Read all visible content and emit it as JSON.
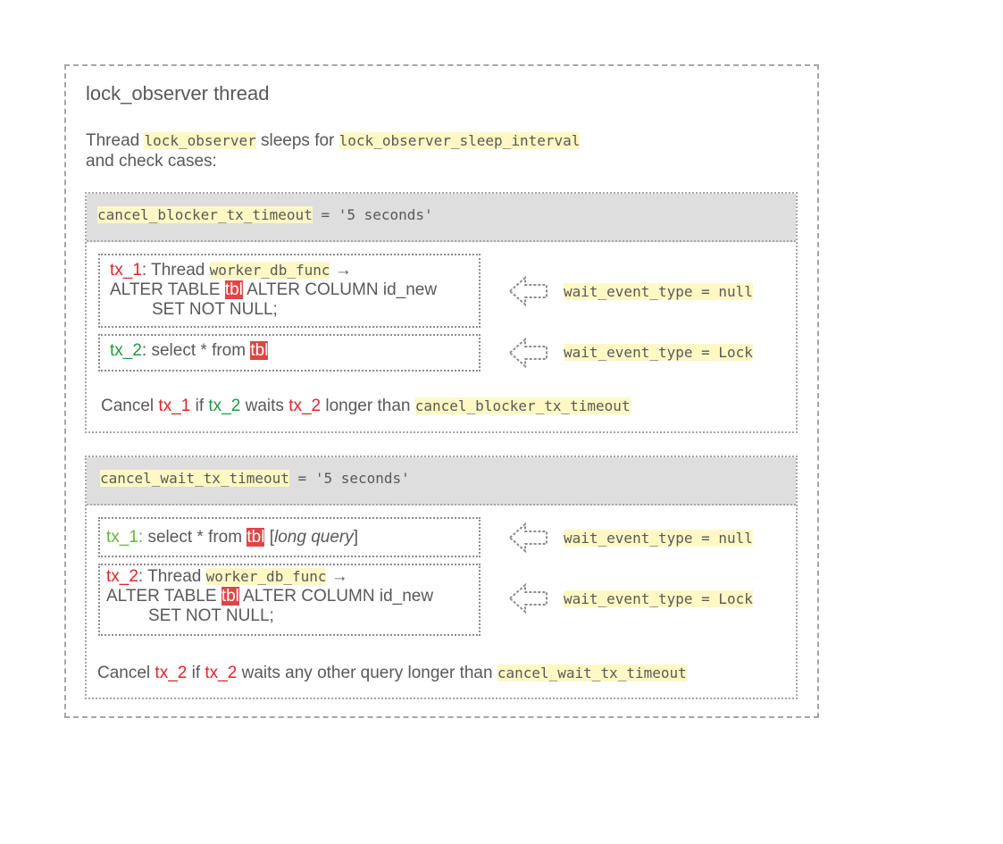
{
  "title": "lock_observer thread",
  "intro": {
    "part1": "Thread ",
    "code1": "lock_observer",
    "part2": " sleeps for ",
    "code2": "lock_observer_sleep_interval",
    "line2": "and check cases:"
  },
  "section1": {
    "param": "cancel_blocker_tx_timeout",
    "value": " = '5 seconds'",
    "tx1": {
      "label": "tx_1",
      "text1": ": Thread ",
      "code": "worker_db_func",
      "arrow": " →",
      "line2a": "ALTER TABLE ",
      "tbl": "tbl",
      "line2b": " ALTER COLUMN id_new",
      "line3": "SET NOT NULL;"
    },
    "tx2": {
      "label": "tx_2",
      "text": ": select * from ",
      "tbl": "tbl"
    },
    "wait1": "wait_event_type = null",
    "wait2": "wait_event_type = Lock",
    "cancel": {
      "p1": "Cancel ",
      "tx1": "tx_1",
      "p2": " if ",
      "tx2a": "tx_2",
      "p3": " waits ",
      "tx2b": "tx_2",
      "p4": " longer than ",
      "code": "cancel_blocker_tx_timeout"
    }
  },
  "section2": {
    "param": "cancel_wait_tx_timeout",
    "value": " = '5 seconds'",
    "tx1": {
      "label": "tx_1:",
      "text": " select * from ",
      "tbl": "tbl",
      "tail1": " [",
      "italic": "long query",
      "tail2": "]"
    },
    "tx2": {
      "label": "tx_2",
      "text1": ": Thread ",
      "code": "worker_db_func",
      "arrow": " →",
      "line2a": "ALTER TABLE ",
      "tbl": "tbl",
      "line2b": " ALTER COLUMN id_new",
      "line3": "SET NOT NULL;"
    },
    "wait1": "wait_event_type = null",
    "wait2": "wait_event_type = Lock",
    "cancel": {
      "p1": "Cancel ",
      "tx2a": "tx_2",
      "p2": " if ",
      "tx2b": "tx_2",
      "p3": " waits any other query longer than ",
      "code": "cancel_wait_tx_timeout"
    }
  },
  "colors": {
    "red": "#e0242a",
    "green": "#1e9b3c",
    "tbl_bg": "#e04545",
    "highlight": "#fff8c4",
    "header_bg": "#dedede",
    "text": "#595959"
  }
}
